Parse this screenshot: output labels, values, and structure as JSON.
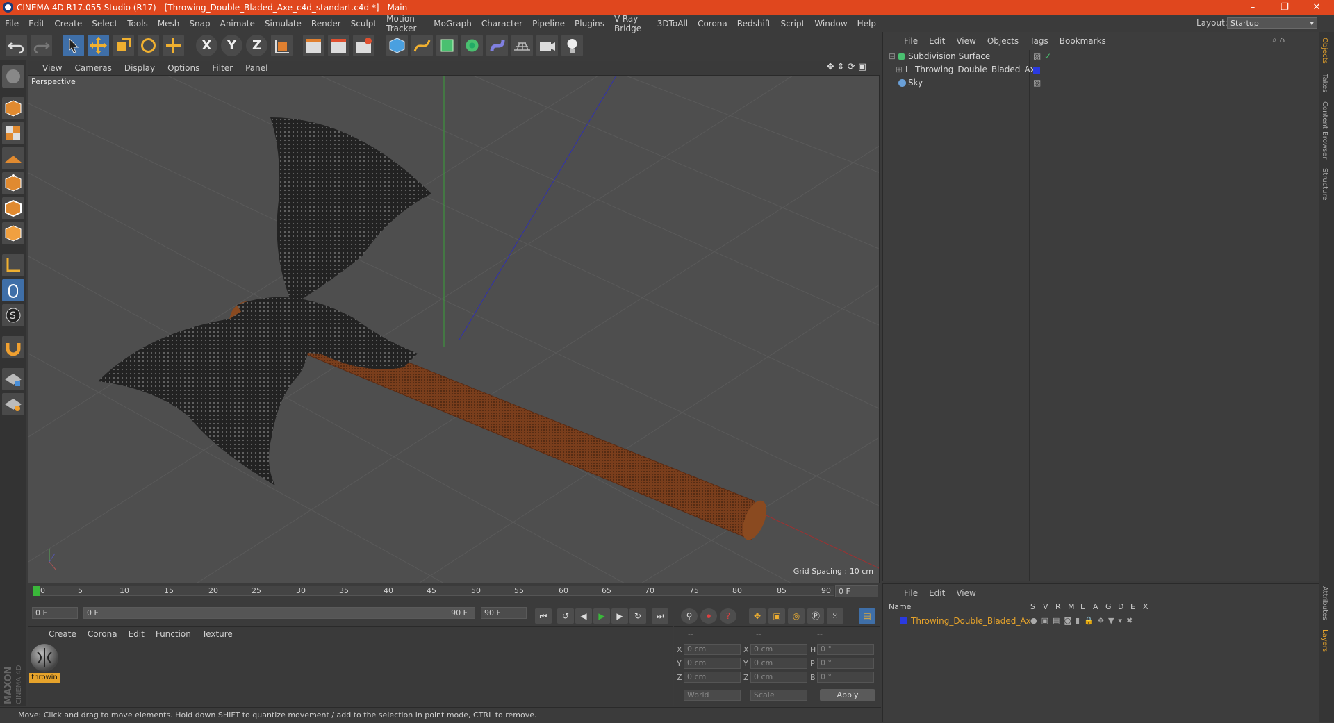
{
  "window": {
    "title": "CINEMA 4D R17.055 Studio (R17) - [Throwing_Double_Bladed_Axe_c4d_standart.c4d *] - Main",
    "controls": [
      "–",
      "❐",
      "✕"
    ]
  },
  "menubar": {
    "items": [
      "File",
      "Edit",
      "Create",
      "Select",
      "Tools",
      "Mesh",
      "Snap",
      "Animate",
      "Simulate",
      "Render",
      "Sculpt",
      "Motion Tracker",
      "MoGraph",
      "Character",
      "Pipeline",
      "Plugins",
      "V-Ray Bridge",
      "3DToAll",
      "Corona",
      "Redshift",
      "Script",
      "Window",
      "Help"
    ],
    "layout_label": "Layout:",
    "layout_value": "Startup"
  },
  "toolbar": {
    "axis_x": "X",
    "axis_y": "Y",
    "axis_z": "Z"
  },
  "viewport": {
    "menu": [
      "View",
      "Cameras",
      "Display",
      "Options",
      "Filter",
      "Panel"
    ],
    "label": "Perspective",
    "grid_spacing": "Grid Spacing : 10 cm"
  },
  "timeline": {
    "ticks": [
      "0",
      "5",
      "10",
      "15",
      "20",
      "25",
      "30",
      "35",
      "40",
      "45",
      "50",
      "55",
      "60",
      "65",
      "70",
      "75",
      "80",
      "85",
      "90"
    ],
    "current_frame": "0 F",
    "start_frame": "0 F",
    "range_start": "0 F",
    "range_end": "90 F",
    "end_frame": "90 F"
  },
  "material_panel": {
    "menu": [
      "Create",
      "Corona",
      "Edit",
      "Function",
      "Texture"
    ],
    "material_name": "throwin"
  },
  "coord_panel": {
    "headers": [
      "--",
      "--",
      "--"
    ],
    "rows": [
      {
        "a": "X",
        "av": "0 cm",
        "b": "X",
        "bv": "0 cm",
        "c": "H",
        "cv": "0 °"
      },
      {
        "a": "Y",
        "av": "0 cm",
        "b": "Y",
        "bv": "0 cm",
        "c": "P",
        "cv": "0 °"
      },
      {
        "a": "Z",
        "av": "0 cm",
        "b": "Z",
        "bv": "0 cm",
        "c": "B",
        "cv": "0 °"
      }
    ],
    "mode": "World",
    "transform": "Scale",
    "apply": "Apply"
  },
  "object_manager": {
    "menu": [
      "File",
      "Edit",
      "View",
      "Objects",
      "Tags",
      "Bookmarks"
    ],
    "objects": [
      {
        "name": "Subdivision Surface"
      },
      {
        "name": "Throwing_Double_Bladed_Axe"
      },
      {
        "name": "Sky"
      }
    ]
  },
  "layer_manager": {
    "menu": [
      "File",
      "Edit",
      "View"
    ],
    "columns": [
      "Name",
      "S",
      "V",
      "R",
      "M",
      "L",
      "A",
      "G",
      "D",
      "E",
      "X"
    ],
    "layer_name": "Throwing_Double_Bladed_Axe"
  },
  "right_tabs": [
    "Objects",
    "Takes",
    "Content Browser",
    "Structure",
    "Attributes",
    "Layers"
  ],
  "status": "Move: Click and drag to move elements. Hold down SHIFT to quantize movement / add to the selection in point mode, CTRL to remove.",
  "branding": {
    "logo_text": "MAXON CINEMA 4D"
  },
  "colors": {
    "accent": "#e0471e",
    "active_tool": "#3f6fa8",
    "layer": "#e6a32b"
  }
}
